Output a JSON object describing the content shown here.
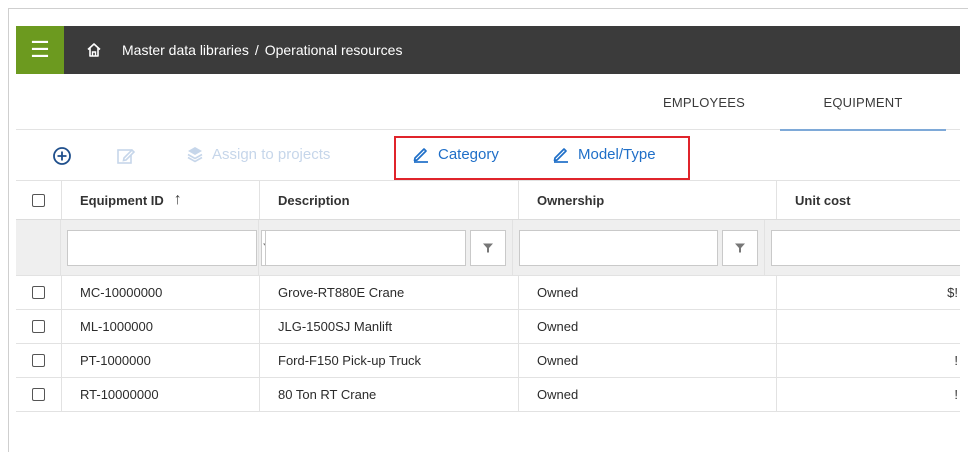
{
  "header": {
    "menu_icon": "hamburger-menu-icon",
    "home_icon": "home-icon",
    "breadcrumb": [
      "Master data libraries",
      "Operational resources"
    ],
    "breadcrumb_separator": "/",
    "menu_color": "#6c9a1f",
    "bar_color": "#3b3b3b"
  },
  "tabs": [
    {
      "label": "EMPLOYEES",
      "active": false
    },
    {
      "label": "EQUIPMENT",
      "active": true
    }
  ],
  "toolbar": {
    "add_icon": "add-circle-icon",
    "edit_icon": "edit-icon",
    "assign_label": "Assign to projects",
    "category_label": "Category",
    "model_label": "Model/Type",
    "accent_color": "#1f6fc8",
    "highlight_color": "#e0242b"
  },
  "table": {
    "columns": [
      "Equipment ID",
      "Description",
      "Ownership",
      "Unit cost"
    ],
    "sort_indicator": "↑",
    "rows": [
      {
        "id": "MC-10000000",
        "description": "Grove-RT880E Crane",
        "ownership": "Owned",
        "unit_cost": "$!"
      },
      {
        "id": "ML-1000000",
        "description": "JLG-1500SJ Manlift",
        "ownership": "Owned",
        "unit_cost": ""
      },
      {
        "id": "PT-1000000",
        "description": "Ford-F150 Pick-up Truck",
        "ownership": "Owned",
        "unit_cost": "!"
      },
      {
        "id": "RT-10000000",
        "description": "80 Ton RT Crane",
        "ownership": "Owned",
        "unit_cost": "!"
      }
    ]
  }
}
